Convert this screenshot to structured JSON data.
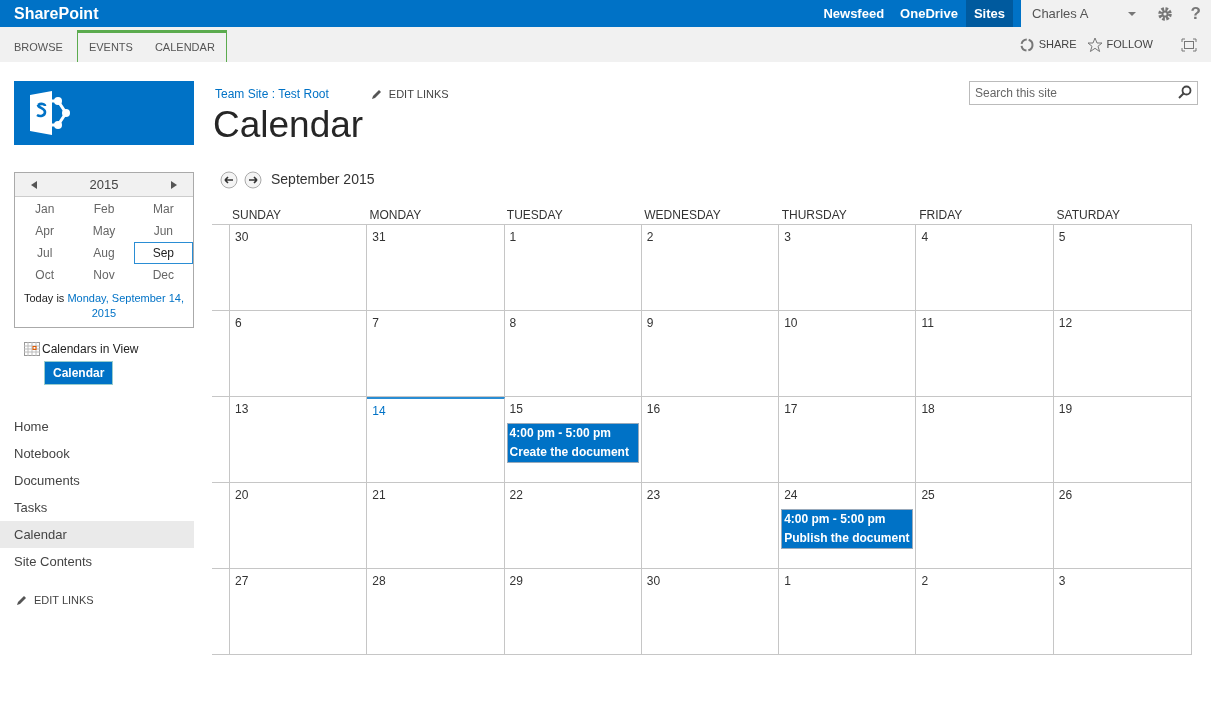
{
  "suite_bar": {
    "brand": "SharePoint",
    "links": [
      {
        "label": "Newsfeed",
        "selected": false
      },
      {
        "label": "OneDrive",
        "selected": false
      },
      {
        "label": "Sites",
        "selected": true
      }
    ],
    "user": "Charles A",
    "help": "?"
  },
  "ribbon": {
    "tabs": [
      {
        "label": "BROWSE",
        "selected": false,
        "contextual": false
      },
      {
        "label": "EVENTS",
        "selected": false,
        "contextual": true
      },
      {
        "label": "CALENDAR",
        "selected": false,
        "contextual": true
      }
    ],
    "actions": [
      {
        "label": "SHARE",
        "kind": "share"
      },
      {
        "label": "FOLLOW",
        "kind": "follow"
      }
    ]
  },
  "breadcrumb": "Team Site : Test Root",
  "edit_links_top": "EDIT LINKS",
  "page_title": "Calendar",
  "search": {
    "placeholder": "Search this site"
  },
  "date_picker": {
    "year": "2015",
    "months": [
      {
        "label": "Jan",
        "selected": false
      },
      {
        "label": "Feb",
        "selected": false
      },
      {
        "label": "Mar",
        "selected": false
      },
      {
        "label": "Apr",
        "selected": false
      },
      {
        "label": "May",
        "selected": false
      },
      {
        "label": "Jun",
        "selected": false
      },
      {
        "label": "Jul",
        "selected": false
      },
      {
        "label": "Aug",
        "selected": false
      },
      {
        "label": "Sep",
        "selected": true
      },
      {
        "label": "Oct",
        "selected": false
      },
      {
        "label": "Nov",
        "selected": false
      },
      {
        "label": "Dec",
        "selected": false
      }
    ],
    "today_label": "Today is",
    "today_link": "Monday, September 14, 2015"
  },
  "calendars_in_view": {
    "title": "Calendars in View",
    "items": [
      "Calendar"
    ]
  },
  "nav": {
    "items": [
      {
        "label": "Home",
        "selected": false
      },
      {
        "label": "Notebook",
        "selected": false
      },
      {
        "label": "Documents",
        "selected": false
      },
      {
        "label": "Tasks",
        "selected": false
      },
      {
        "label": "Calendar",
        "selected": true
      },
      {
        "label": "Site Contents",
        "selected": false
      }
    ],
    "edit_links": "EDIT LINKS"
  },
  "calendar": {
    "month": "September 2015",
    "weekdays": [
      "SUNDAY",
      "MONDAY",
      "TUESDAY",
      "WEDNESDAY",
      "THURSDAY",
      "FRIDAY",
      "SATURDAY"
    ],
    "weeks": [
      [
        {
          "day": "30",
          "today": false
        },
        {
          "day": "31",
          "today": false
        },
        {
          "day": "1",
          "today": false
        },
        {
          "day": "2",
          "today": false
        },
        {
          "day": "3",
          "today": false
        },
        {
          "day": "4",
          "today": false
        },
        {
          "day": "5",
          "today": false
        }
      ],
      [
        {
          "day": "6",
          "today": false
        },
        {
          "day": "7",
          "today": false
        },
        {
          "day": "8",
          "today": false
        },
        {
          "day": "9",
          "today": false
        },
        {
          "day": "10",
          "today": false
        },
        {
          "day": "11",
          "today": false
        },
        {
          "day": "12",
          "today": false
        }
      ],
      [
        {
          "day": "13",
          "today": false
        },
        {
          "day": "14",
          "today": true
        },
        {
          "day": "15",
          "today": false,
          "events": [
            {
              "time": "4:00 pm - 5:00 pm",
              "title": "Create the document"
            }
          ]
        },
        {
          "day": "16",
          "today": false
        },
        {
          "day": "17",
          "today": false
        },
        {
          "day": "18",
          "today": false
        },
        {
          "day": "19",
          "today": false
        }
      ],
      [
        {
          "day": "20",
          "today": false
        },
        {
          "day": "21",
          "today": false
        },
        {
          "day": "22",
          "today": false
        },
        {
          "day": "23",
          "today": false
        },
        {
          "day": "24",
          "today": false,
          "events": [
            {
              "time": "4:00 pm - 5:00 pm",
              "title": "Publish the document"
            }
          ]
        },
        {
          "day": "25",
          "today": false
        },
        {
          "day": "26",
          "today": false
        }
      ],
      [
        {
          "day": "27",
          "today": false
        },
        {
          "day": "28",
          "today": false
        },
        {
          "day": "29",
          "today": false
        },
        {
          "day": "30",
          "today": false
        },
        {
          "day": "1",
          "today": false
        },
        {
          "day": "2",
          "today": false
        },
        {
          "day": "3",
          "today": false
        }
      ]
    ]
  }
}
